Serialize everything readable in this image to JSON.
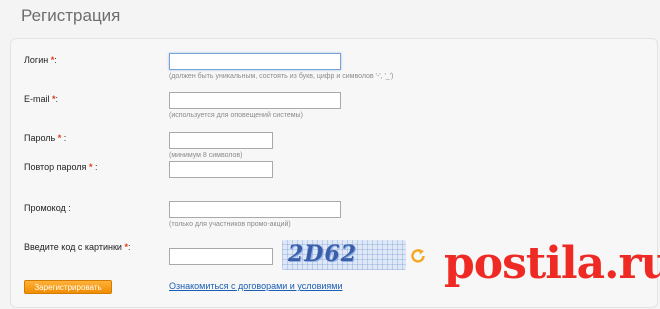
{
  "page": {
    "title": "Регистрация"
  },
  "form": {
    "login": {
      "label": "Логин",
      "hint": "(должен быть уникальным, состоять из букв, цифр и символов '-', '_')",
      "value": ""
    },
    "email": {
      "label": "E-mail",
      "hint": "(используется для оповещений системы)",
      "value": ""
    },
    "password": {
      "label": "Пароль",
      "hint": "(минимум 8 символов)",
      "value": ""
    },
    "password_repeat": {
      "label": "Повтор пароля",
      "value": ""
    },
    "promo": {
      "label": "Промокод",
      "hint": "(только для участников промо-акций)",
      "value": ""
    },
    "captcha": {
      "label": "Введите код с картинки",
      "image_text": "2D62",
      "value": ""
    },
    "required_mark": "*",
    "colon": ":",
    "submit_label": "Зарегистрировать",
    "terms_link": "Ознакомиться с договорами и условиями"
  },
  "watermark": {
    "text": "postila.ru",
    "color": "#ef2a24"
  },
  "colors": {
    "accent": "#f5a623",
    "required": "#e03a1a",
    "link": "#1a5fb4"
  }
}
